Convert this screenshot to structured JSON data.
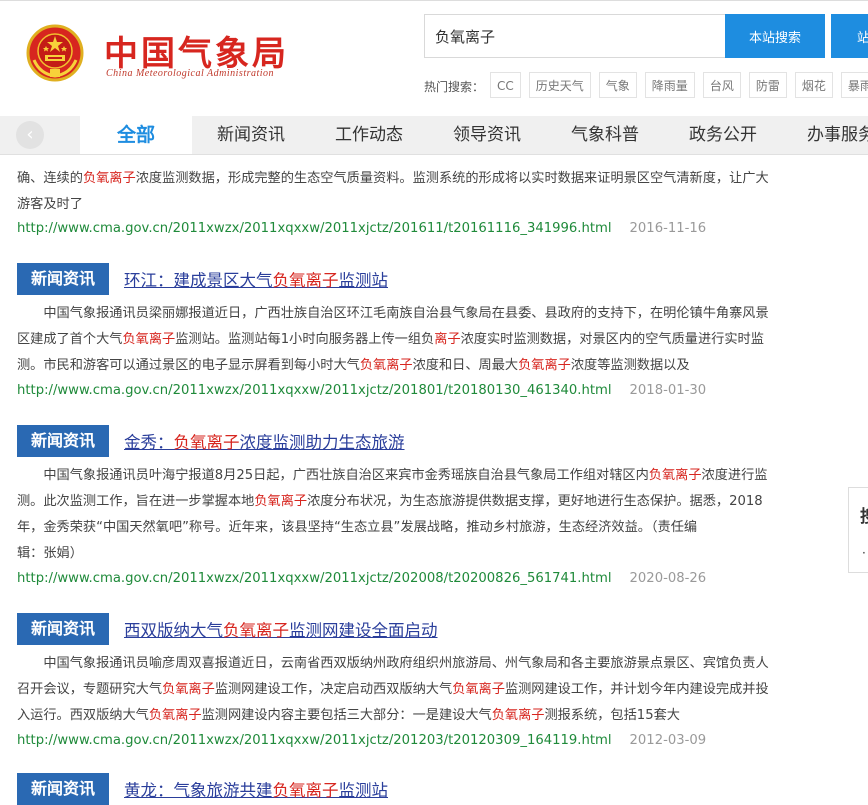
{
  "header": {
    "logo_cn": "中国气象局",
    "logo_en": "China Meteorological Administration",
    "search_value": "负氧离子",
    "search_button": "本站搜索",
    "search_button2": "站",
    "hot_label": "热门搜索：",
    "hot_tags": [
      "CC",
      "历史天气",
      "气象",
      "降雨量",
      "台风",
      "防雷",
      "烟花",
      "暴雨"
    ]
  },
  "nav": {
    "back_icon": "‹",
    "items": [
      "全部",
      "新闻资讯",
      "工作动态",
      "领导资讯",
      "气象科普",
      "政务公开",
      "办事服务"
    ]
  },
  "results": [
    {
      "badge": "",
      "title_parts": [],
      "snippet_lines": [
        [
          {
            "t": "确、连续的"
          },
          {
            "t": "负氧离子",
            "h": true
          },
          {
            "t": "浓度监测数据，形成完整的生态空气质量资料。监测系统的形成将以实时数据来证明景区空气清新度，让广大"
          }
        ],
        [
          {
            "t": "游客及时了"
          }
        ]
      ],
      "url": "http://www.cma.gov.cn/2011xwzx/2011xqxxw/2011xjctz/201611/t20161116_341996.html",
      "date": "2016-11-16"
    },
    {
      "badge": "新闻资讯",
      "title_parts": [
        {
          "t": "环江：建成景区大气"
        },
        {
          "t": "负氧离子",
          "h": true
        },
        {
          "t": "监测站"
        }
      ],
      "snippet_lines": [
        [
          {
            "t": "　　中国气象报通讯员梁丽娜报道近日，广西壮族自治区环江毛南族自治县气象局在县委、县政府的支持下，在明伦镇牛角寨风景"
          }
        ],
        [
          {
            "t": "区建成了首个大气"
          },
          {
            "t": "负氧离子",
            "h": true
          },
          {
            "t": "监测站。监测站每1小时向服务器上传一组负"
          },
          {
            "t": "离子",
            "h": true
          },
          {
            "t": "浓度实时监测数据，对景区内的空气质量进行实时监"
          }
        ],
        [
          {
            "t": "测。市民和游客可以通过景区的电子显示屏看到每小时大气"
          },
          {
            "t": "负氧离子",
            "h": true
          },
          {
            "t": "浓度和日、周最大"
          },
          {
            "t": "负氧离子",
            "h": true
          },
          {
            "t": "浓度等监测数据以及"
          }
        ]
      ],
      "url": "http://www.cma.gov.cn/2011xwzx/2011xqxxw/2011xjctz/201801/t20180130_461340.html",
      "date": "2018-01-30"
    },
    {
      "badge": "新闻资讯",
      "title_parts": [
        {
          "t": "金秀："
        },
        {
          "t": "负氧离子",
          "h": true
        },
        {
          "t": "浓度监测助力生态旅游"
        }
      ],
      "snippet_lines": [
        [
          {
            "t": "　　中国气象报通讯员叶海宁报道8月25日起，广西壮族自治区来宾市金秀瑶族自治县气象局工作组对辖区内"
          },
          {
            "t": "负氧离子",
            "h": true
          },
          {
            "t": "浓度进行监"
          }
        ],
        [
          {
            "t": "测。此次监测工作，旨在进一步掌握本地"
          },
          {
            "t": "负氧离子",
            "h": true
          },
          {
            "t": "浓度分布状况，为生态旅游提供数据支撑，更好地进行生态保护。据悉，2018"
          }
        ],
        [
          {
            "t": "年，金秀荣获“中国天然氧吧”称号。近年来，该县坚持“生态立县”发展战略，推动乡村旅游，生态经济效益。（责任编"
          }
        ],
        [
          {
            "t": "辑：张娟）"
          }
        ]
      ],
      "url": "http://www.cma.gov.cn/2011xwzx/2011xqxxw/2011xjctz/202008/t20200826_561741.html",
      "date": "2020-08-26"
    },
    {
      "badge": "新闻资讯",
      "title_parts": [
        {
          "t": "西双版纳大气"
        },
        {
          "t": "负氧离子",
          "h": true
        },
        {
          "t": "监测网建设全面启动"
        }
      ],
      "snippet_lines": [
        [
          {
            "t": "　　中国气象报通讯员喻彦周双喜报道近日，云南省西双版纳州政府组织州旅游局、州气象局和各主要旅游景点景区、宾馆负责人"
          }
        ],
        [
          {
            "t": "召开会议，专题研究大气"
          },
          {
            "t": "负氧离子",
            "h": true
          },
          {
            "t": "监测网建设工作，决定启动西双版纳大气"
          },
          {
            "t": "负氧离子",
            "h": true
          },
          {
            "t": "监测网建设工作，并计划今年内建设完成并投"
          }
        ],
        [
          {
            "t": "入运行。西双版纳大气"
          },
          {
            "t": "负氧离子",
            "h": true
          },
          {
            "t": "监测网建设内容主要包括三大部分：一是建设大气"
          },
          {
            "t": "负氧离子",
            "h": true
          },
          {
            "t": "测报系统，包括15套大"
          }
        ]
      ],
      "url": "http://www.cma.gov.cn/2011xwzx/2011xqxxw/2011xjctz/201203/t20120309_164119.html",
      "date": "2012-03-09"
    },
    {
      "badge": "新闻资讯",
      "title_parts": [
        {
          "t": "黄龙：气象旅游共建"
        },
        {
          "t": "负氧离子",
          "h": true
        },
        {
          "t": "监测站"
        }
      ],
      "snippet_lines": [],
      "url": "",
      "date": ""
    }
  ],
  "side_panel": {
    "title": "搜",
    "dot": "·"
  },
  "colors": {
    "accent": "#1e8de0",
    "badge": "#2a69b3",
    "highlight": "#d7261f",
    "url": "#1f8a3a"
  }
}
